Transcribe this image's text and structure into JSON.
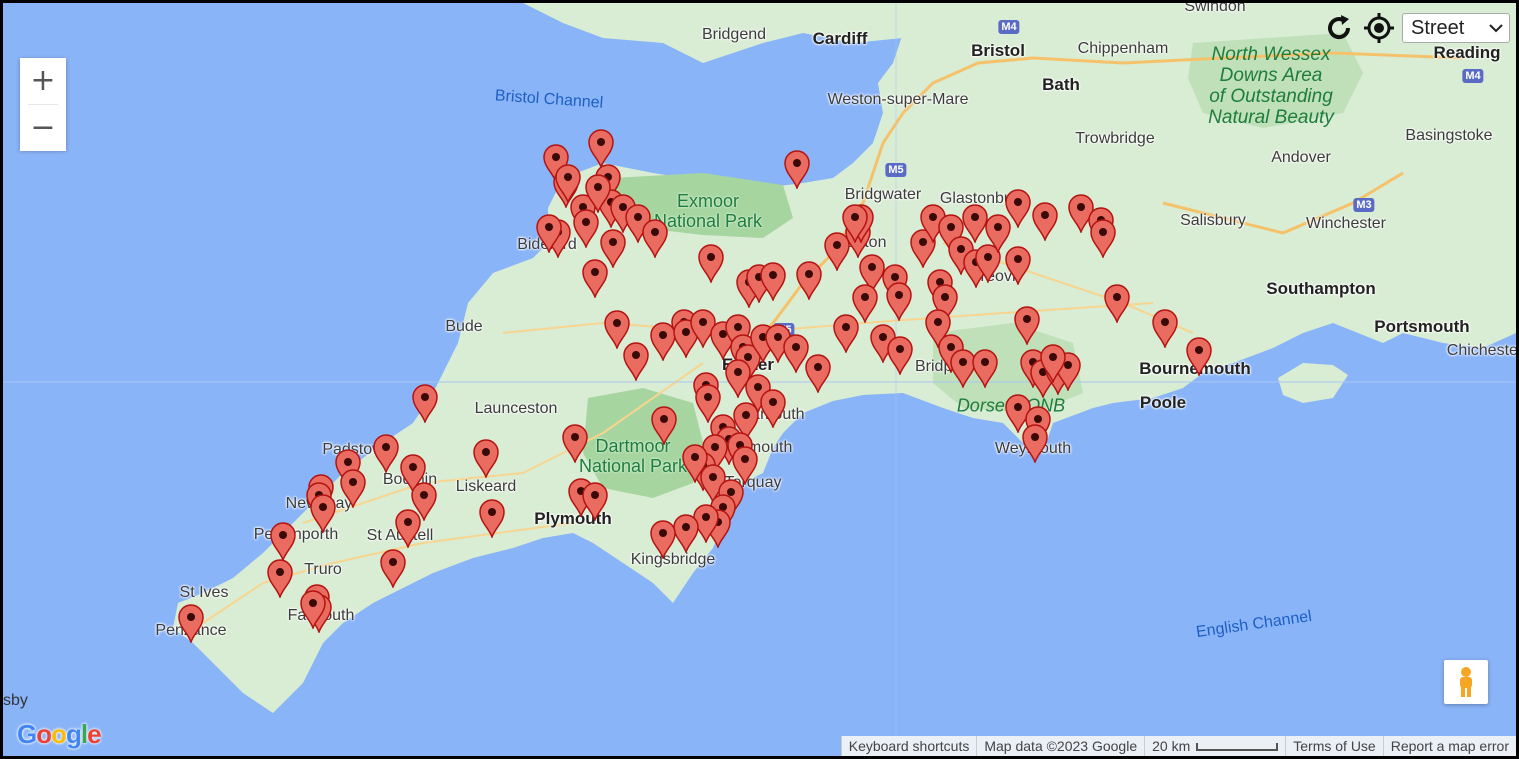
{
  "map": {
    "map_type_selected": "Street",
    "zoom_in_label": "+",
    "zoom_out_label": "−",
    "colors": {
      "sea": "#8ab4f8",
      "land": "#d9ecd4",
      "park": "#a6d5a0",
      "marker_fill": "#ea6b60",
      "marker_stroke": "#b31412",
      "road": "#f5c26b"
    },
    "places": [
      {
        "id": "swindon",
        "label": "Swindon"
      },
      {
        "id": "bridgend",
        "label": "Bridgend"
      },
      {
        "id": "cardiff",
        "label": "Cardiff"
      },
      {
        "id": "bristol",
        "label": "Bristol"
      },
      {
        "id": "chippenham",
        "label": "Chippenham"
      },
      {
        "id": "reading",
        "label": "Reading"
      },
      {
        "id": "bath",
        "label": "Bath"
      },
      {
        "id": "weston",
        "label": "Weston-super-Mare"
      },
      {
        "id": "trowbridge",
        "label": "Trowbridge"
      },
      {
        "id": "basingstoke",
        "label": "Basingstoke"
      },
      {
        "id": "andover",
        "label": "Andover"
      },
      {
        "id": "bridgwater",
        "label": "Bridgwater"
      },
      {
        "id": "salisbury",
        "label": "Salisbury"
      },
      {
        "id": "winchester",
        "label": "Winchester"
      },
      {
        "id": "bideford",
        "label": "Bideford"
      },
      {
        "id": "southampton",
        "label": "Southampton"
      },
      {
        "id": "bude",
        "label": "Bude"
      },
      {
        "id": "portsmouth",
        "label": "Portsmouth"
      },
      {
        "id": "chichester",
        "label": "Chichester"
      },
      {
        "id": "bournemouth",
        "label": "Bournemouth"
      },
      {
        "id": "poole",
        "label": "Poole"
      },
      {
        "id": "launceston",
        "label": "Launceston"
      },
      {
        "id": "padstow",
        "label": "Padstow"
      },
      {
        "id": "bodmin",
        "label": "Bodmin"
      },
      {
        "id": "liskeard",
        "label": "Liskeard"
      },
      {
        "id": "newquay",
        "label": "Newquay"
      },
      {
        "id": "plymouth",
        "label": "Plymouth"
      },
      {
        "id": "perranporth",
        "label": "Perranporth"
      },
      {
        "id": "staustell",
        "label": "St Austell"
      },
      {
        "id": "truro",
        "label": "Truro"
      },
      {
        "id": "stives",
        "label": "St Ives"
      },
      {
        "id": "penzance",
        "label": "Penzance"
      },
      {
        "id": "falmouth",
        "label": "Falmouth"
      },
      {
        "id": "kingsbridge",
        "label": "Kingsbridge"
      },
      {
        "id": "teignmouth",
        "label": "Teignmouth"
      },
      {
        "id": "torquay",
        "label": "Torquay"
      },
      {
        "id": "exmouth",
        "label": "Exmouth"
      },
      {
        "id": "exeter",
        "label": "Exeter"
      },
      {
        "id": "bridport",
        "label": "Bridport"
      },
      {
        "id": "weymouth",
        "label": "Weymouth"
      },
      {
        "id": "yeovil",
        "label": "Yeovil"
      },
      {
        "id": "glastonbury",
        "label": "Glastonbury"
      },
      {
        "id": "taunton",
        "label": "Taunton"
      }
    ],
    "parks": {
      "exmoor": "Exmoor\nNational Park",
      "dartmoor": "Dartmoor\nNational Park",
      "north_wessex": "North Wessex\nDowns Area\nof Outstanding\nNatural Beauty",
      "dorset_aonb": "Dorset AONB"
    },
    "water_labels": {
      "bristol_channel": "Bristol Channel",
      "english_channel": "English Channel"
    },
    "road_shields": [
      "M4",
      "M4",
      "M5",
      "M5",
      "M3"
    ],
    "partial_label": "sby",
    "logo_text": "Google",
    "footer": {
      "keyboard": "Keyboard shortcuts",
      "mapdata": "Map data ©2023 Google",
      "scale": "20 km",
      "terms": "Terms of Use",
      "report": "Report a map error"
    }
  }
}
